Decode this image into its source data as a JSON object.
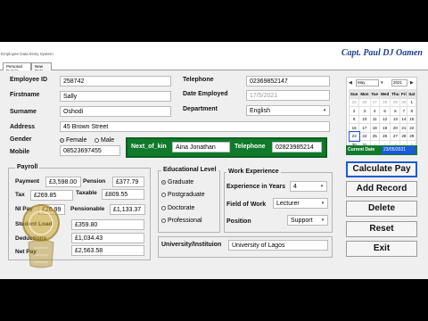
{
  "window": {
    "title": "Employee Data Entry System",
    "brand": "Capt. Paul DJ Oamen"
  },
  "tabs": [
    {
      "label": "Personal Details"
    },
    {
      "label": "New Data"
    }
  ],
  "personal": {
    "employee_id_label": "Employee ID",
    "employee_id": "258742",
    "firstname_label": "Firstname",
    "firstname": "Sally",
    "surname_label": "Surname",
    "surname": "Oshodi",
    "address_label": "Address",
    "address": "45 Brown Street",
    "gender_label": "Gender",
    "gender_female": "Female",
    "gender_male": "Male",
    "mobile_label": "Mobile",
    "mobile": "08523697455",
    "telephone_label": "Telephone",
    "telephone": "02369852147",
    "date_employed_label": "Date Employed",
    "date_employed": "17/5/2021",
    "department_label": "Department",
    "department": "English"
  },
  "next_of_kin": {
    "label": "Next_of_kin",
    "name": "Aina Jonathan",
    "telephone_label": "Telephone",
    "telephone": "02823985214"
  },
  "payroll": {
    "legend": "Payroll",
    "payment_label": "Payment",
    "payment": "£3,598.00",
    "pension_label": "Pension",
    "pension": "£377.79",
    "tax_label": "Tax",
    "tax": "£269.85",
    "taxable_label": "Taxable",
    "taxable": "£809.55",
    "ni_pay_label": "NI Pay",
    "ni_pay": "£26.99",
    "pensionable_label": "Pensionable",
    "pensionable": "£1,133.37",
    "student_load_label": "Student Load",
    "student_load": "£359.80",
    "deductions_label": "Deductions",
    "deductions": "£1,034.43",
    "net_pay_label": "Net Pay",
    "net_pay": "£2,563.58"
  },
  "education": {
    "legend": "Educational Level",
    "options": [
      "Graduate",
      "Postgraduate",
      "Doctorate",
      "Professional"
    ],
    "selected": "Graduate"
  },
  "work": {
    "legend": "Work Experience",
    "years_label": "Experience in Years",
    "years": "4",
    "field_label": "Field of Work",
    "field": "Lecturer",
    "position_label": "Position",
    "position": "Support"
  },
  "university": {
    "label": "University/Instituion",
    "value": "University of Lagos"
  },
  "calendar": {
    "month": "May",
    "year": "2021",
    "weekdays": [
      "Sun",
      "Mon",
      "Tue",
      "Wed",
      "Thu",
      "Fri",
      "Sat"
    ],
    "weeks": [
      [
        "25",
        "26",
        "27",
        "28",
        "29",
        "30",
        "1"
      ],
      [
        "2",
        "3",
        "4",
        "5",
        "6",
        "7",
        "8"
      ],
      [
        "9",
        "10",
        "11",
        "12",
        "13",
        "14",
        "15"
      ],
      [
        "16",
        "17",
        "18",
        "19",
        "20",
        "21",
        "22"
      ],
      [
        "23",
        "24",
        "25",
        "26",
        "27",
        "28",
        "29"
      ],
      [
        "30",
        "31",
        "1",
        "2",
        "3",
        "4",
        "5"
      ]
    ],
    "current_label": "Current Date",
    "current_value": "23/05/2021"
  },
  "buttons": {
    "calculate": "Calculate Pay",
    "add": "Add Record",
    "delete": "Delete",
    "reset": "Reset",
    "exit": "Exit"
  },
  "colors": {
    "accent_green": "#0f7a2a",
    "brand_blue": "#1a3f8c",
    "focus_blue": "#1a5bd8"
  }
}
